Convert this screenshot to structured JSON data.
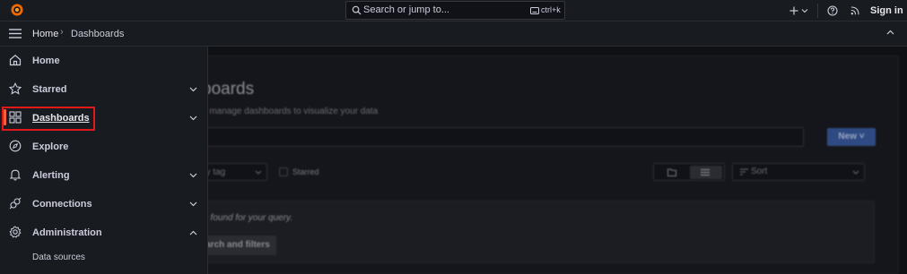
{
  "topbar": {
    "logo_icon": "grafana-logo-icon",
    "search_placeholder": "Search or jump to...",
    "search_shortcut": "ctrl+k",
    "add_icon": "plus-icon",
    "help_icon": "help-circle-icon",
    "news_icon": "rss-icon",
    "sign_in": "Sign in"
  },
  "breadcrumb": {
    "home": "Home",
    "separator": "›",
    "current": "Dashboards"
  },
  "sidebar": {
    "items": [
      {
        "label": "Home",
        "icon": "home-icon"
      },
      {
        "label": "Starred",
        "icon": "star-icon"
      },
      {
        "label": "Dashboards",
        "icon": "apps-icon"
      },
      {
        "label": "Explore",
        "icon": "compass-icon"
      },
      {
        "label": "Alerting",
        "icon": "bell-icon"
      },
      {
        "label": "Connections",
        "icon": "plug-icon"
      },
      {
        "label": "Administration",
        "icon": "cog-icon"
      }
    ],
    "subitems": [
      {
        "label": "Data sources"
      }
    ]
  },
  "main": {
    "title": "boards",
    "subtitle": "d manage dashboards to visualize your data",
    "new_button": "New",
    "tag_filter": "by tag",
    "starred_label": "Starred",
    "sort_label": "Sort",
    "empty_message": "ts found for your query.",
    "clear_button": "search and filters"
  },
  "colors": {
    "accent_active": "#f55f3e",
    "highlight_outline": "#e0191b",
    "primary_button": "#2f4a82"
  }
}
